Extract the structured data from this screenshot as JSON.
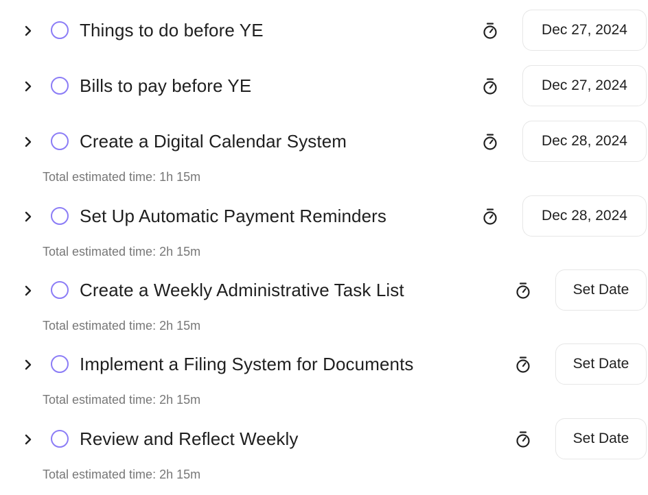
{
  "tasks": [
    {
      "title": "Things to do before YE",
      "date_label": "Dec 27, 2024",
      "has_date": true,
      "estimate": ""
    },
    {
      "title": "Bills to pay before YE",
      "date_label": "Dec 27, 2024",
      "has_date": true,
      "estimate": ""
    },
    {
      "title": "Create a Digital Calendar System",
      "date_label": "Dec 28, 2024",
      "has_date": true,
      "estimate": "Total estimated time: 1h 15m"
    },
    {
      "title": "Set Up Automatic Payment Reminders",
      "date_label": "Dec 28, 2024",
      "has_date": true,
      "estimate": "Total estimated time: 2h 15m"
    },
    {
      "title": "Create a Weekly Administrative Task List",
      "date_label": "Set Date",
      "has_date": false,
      "estimate": "Total estimated time: 2h 15m"
    },
    {
      "title": "Implement a Filing System for Documents",
      "date_label": "Set Date",
      "has_date": false,
      "estimate": "Total estimated time: 2h 15m"
    },
    {
      "title": "Review and Reflect Weekly",
      "date_label": "Set Date",
      "has_date": false,
      "estimate": "Total estimated time: 2h 15m"
    }
  ],
  "icons": {
    "expand": "chevron-right-icon",
    "complete": "circle-checkbox-icon",
    "timer": "stopwatch-icon"
  },
  "colors": {
    "checkbox_border": "#8b7cf6",
    "title_text": "#1f1f1f",
    "estimate_text": "#777777",
    "button_border": "#e6e6e6"
  }
}
